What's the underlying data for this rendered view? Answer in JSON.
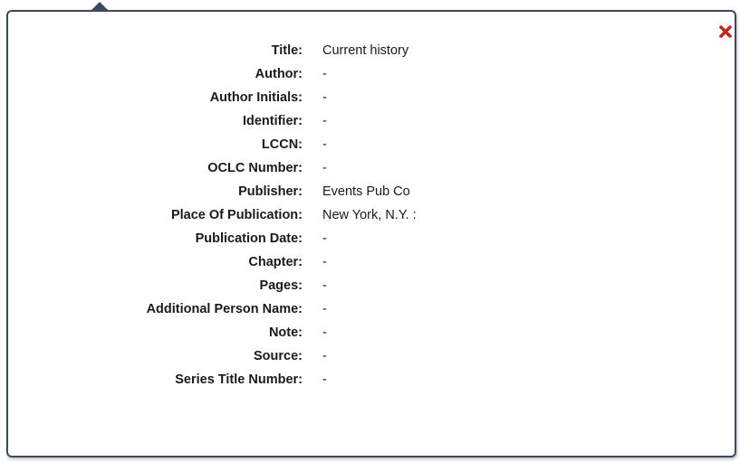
{
  "popup": {
    "close_icon": "close-x-icon",
    "accent_close": "#c0261d",
    "border_color": "#3b4a5c",
    "fields": [
      {
        "label": "Title:",
        "value": "Current history"
      },
      {
        "label": "Author:",
        "value": "-"
      },
      {
        "label": "Author Initials:",
        "value": "-"
      },
      {
        "label": "Identifier:",
        "value": "-"
      },
      {
        "label": "LCCN:",
        "value": "-"
      },
      {
        "label": "OCLC Number:",
        "value": "-"
      },
      {
        "label": "Publisher:",
        "value": "Events Pub Co"
      },
      {
        "label": "Place Of Publication:",
        "value": "New York, N.Y. :"
      },
      {
        "label": "Publication Date:",
        "value": "-"
      },
      {
        "label": "Chapter:",
        "value": "-"
      },
      {
        "label": "Pages:",
        "value": "-"
      },
      {
        "label": "Additional Person Name:",
        "value": "-"
      },
      {
        "label": "Note:",
        "value": "-"
      },
      {
        "label": "Source:",
        "value": "-"
      },
      {
        "label": "Series Title Number:",
        "value": "-"
      }
    ]
  }
}
